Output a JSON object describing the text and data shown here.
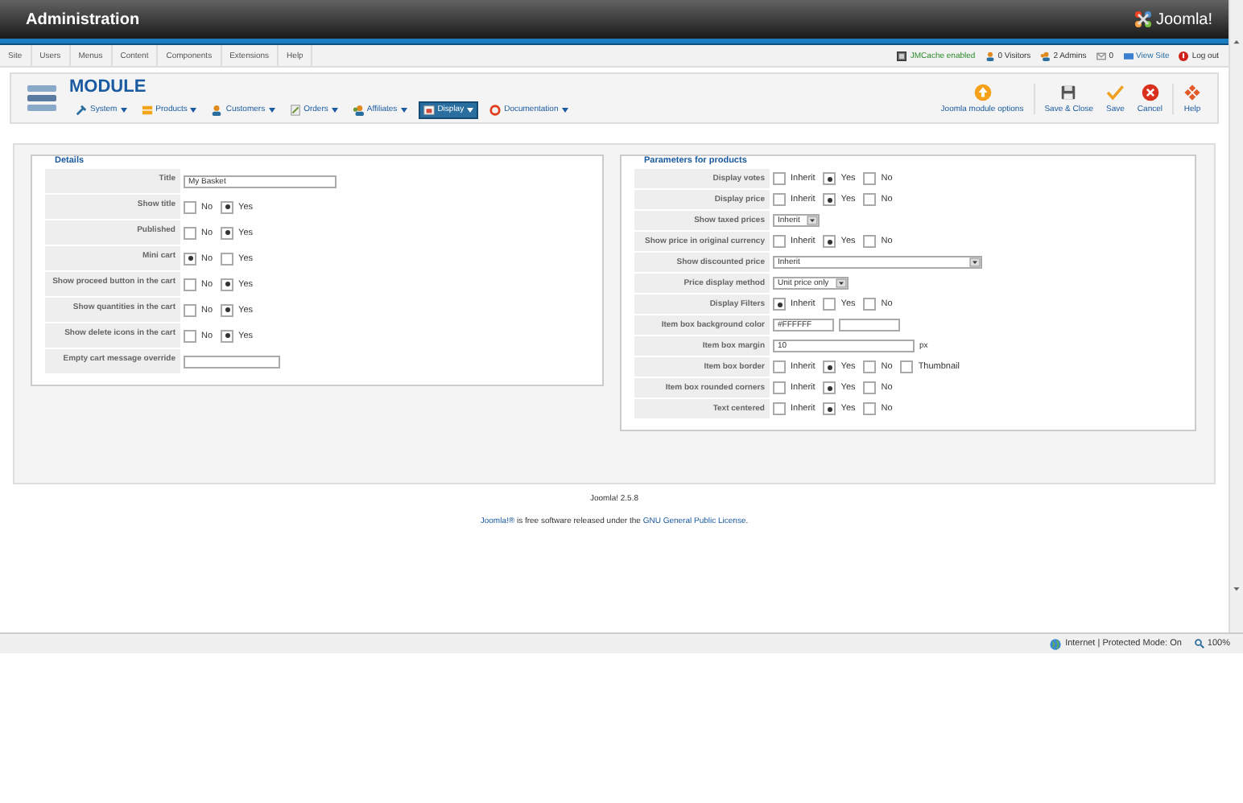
{
  "header": {
    "title": "Administration",
    "logo": "Joomla!"
  },
  "menu": [
    "Site",
    "Users",
    "Menus",
    "Content",
    "Components",
    "Extensions",
    "Help"
  ],
  "status": [
    {
      "kind": "cache",
      "label": "JMCache enabled"
    },
    {
      "kind": "visitors",
      "label": "0 Visitors"
    },
    {
      "kind": "admins",
      "label": "2 Admins"
    },
    {
      "kind": "mail",
      "label": "0"
    },
    {
      "kind": "view",
      "label": "View Site"
    },
    {
      "kind": "logout",
      "label": "Log out"
    }
  ],
  "toolbar": {
    "title": "MODULE",
    "submenu": [
      {
        "kind": "system",
        "label": "System",
        "selected": false
      },
      {
        "kind": "products",
        "label": "Products",
        "selected": false
      },
      {
        "kind": "customers",
        "label": "Customers",
        "selected": false
      },
      {
        "kind": "orders",
        "label": "Orders",
        "selected": false
      },
      {
        "kind": "affiliates",
        "label": "Affiliates",
        "selected": false
      },
      {
        "kind": "display",
        "label": "Display",
        "selected": true
      },
      {
        "kind": "docs",
        "label": "Documentation",
        "selected": false
      }
    ],
    "buttons": [
      {
        "kind": "options",
        "label": "Joomla module options"
      },
      {
        "kind": "save-close",
        "label": "Save & Close"
      },
      {
        "kind": "save",
        "label": "Save"
      },
      {
        "kind": "cancel",
        "label": "Cancel"
      },
      {
        "kind": "help",
        "label": "Help"
      }
    ]
  },
  "details": {
    "title": "Details",
    "fields": [
      {
        "label": "Title",
        "kind": "text",
        "value": "My Basket"
      },
      {
        "label": "Show title",
        "kind": "radio",
        "options": [
          {
            "label": "No",
            "selected": false
          },
          {
            "label": "Yes",
            "selected": true
          }
        ]
      },
      {
        "label": "Published",
        "kind": "radio",
        "options": [
          {
            "label": "No",
            "selected": false
          },
          {
            "label": "Yes",
            "selected": true
          }
        ]
      },
      {
        "label": "Mini cart",
        "kind": "radio",
        "options": [
          {
            "label": "No",
            "selected": true
          },
          {
            "label": "Yes",
            "selected": false
          }
        ]
      },
      {
        "label": "Show proceed button in the cart",
        "kind": "radio",
        "options": [
          {
            "label": "No",
            "selected": false
          },
          {
            "label": "Yes",
            "selected": true
          }
        ]
      },
      {
        "label": "Show quantities in the cart",
        "kind": "radio",
        "options": [
          {
            "label": "No",
            "selected": false
          },
          {
            "label": "Yes",
            "selected": true
          }
        ]
      },
      {
        "label": "Show delete icons in the cart",
        "kind": "radio",
        "options": [
          {
            "label": "No",
            "selected": false
          },
          {
            "label": "Yes",
            "selected": true
          }
        ]
      },
      {
        "label": "Empty cart message override",
        "kind": "text"
      }
    ]
  },
  "params": {
    "title": "Parameters for products",
    "fields": [
      {
        "label": "Display votes",
        "kind": "radio",
        "options": [
          {
            "label": "Inherit",
            "selected": false
          },
          {
            "label": "Yes",
            "selected": true
          },
          {
            "label": "No",
            "selected": false
          }
        ]
      },
      {
        "label": "Display price",
        "kind": "radio",
        "options": [
          {
            "label": "Inherit",
            "selected": false
          },
          {
            "label": "Yes",
            "selected": true
          },
          {
            "label": "No",
            "selected": false
          }
        ]
      },
      {
        "label": "Show taxed prices",
        "kind": "select",
        "value": "Inherit"
      },
      {
        "label": "Show price in original currency",
        "kind": "radio",
        "options": [
          {
            "label": "Inherit",
            "selected": false
          },
          {
            "label": "Yes",
            "selected": true
          },
          {
            "label": "No",
            "selected": false
          }
        ]
      },
      {
        "label": "Show discounted price",
        "kind": "wide-select",
        "value": "Inherit"
      },
      {
        "label": "Price display method",
        "kind": "select",
        "value": "Unit price only"
      },
      {
        "label": "Display Filters",
        "kind": "radio",
        "options": [
          {
            "label": "Inherit",
            "selected": true
          },
          {
            "label": "Yes",
            "selected": false
          },
          {
            "label": "No",
            "selected": false
          }
        ]
      },
      {
        "label": "Item box background color",
        "kind": "color",
        "value": "#FFFFFF"
      },
      {
        "label": "Item box margin",
        "kind": "number",
        "value": "10",
        "unit": "px"
      },
      {
        "label": "Item box border",
        "kind": "radio",
        "options": [
          {
            "label": "Inherit",
            "selected": false
          },
          {
            "label": "Yes",
            "selected": true
          },
          {
            "label": "No",
            "selected": false
          },
          {
            "label": "Thumbnail",
            "selected": false
          }
        ]
      },
      {
        "label": "Item box rounded corners",
        "kind": "radio",
        "options": [
          {
            "label": "Inherit",
            "selected": false
          },
          {
            "label": "Yes",
            "selected": true
          },
          {
            "label": "No",
            "selected": false
          }
        ]
      },
      {
        "label": "Text centered",
        "kind": "radio",
        "options": [
          {
            "label": "Inherit",
            "selected": false
          },
          {
            "label": "Yes",
            "selected": true
          },
          {
            "label": "No",
            "selected": false
          }
        ]
      }
    ]
  },
  "footer": {
    "version": "Joomla! 2.5.8",
    "link": "Joomla!®",
    "text": " is free software released under the ",
    "link2": "GNU General Public License",
    "end": "."
  },
  "browser": {
    "zone": "Internet | Protected Mode: On",
    "zoom": "100%"
  }
}
